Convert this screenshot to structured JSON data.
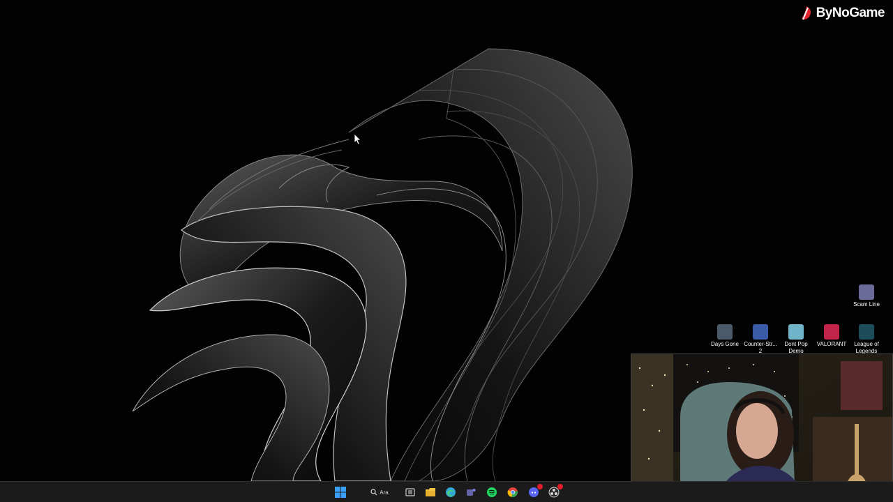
{
  "watermark": {
    "text": "ByNoGame"
  },
  "desktop_icons": [
    {
      "label": "Scam Line",
      "icon": "scam-line-icon",
      "color": "#6b6b9a"
    },
    {
      "label": "Days Gone",
      "icon": "days-gone-icon",
      "color": "#4a5a6a"
    },
    {
      "label": "Counter-Str... 2",
      "icon": "counter-strike-icon",
      "color": "#3a5ba8"
    },
    {
      "label": "Dont Pop Demo",
      "icon": "dont-pop-demo-icon",
      "color": "#6fb4c9"
    },
    {
      "label": "VALORANT",
      "icon": "valorant-icon",
      "color": "#c2254a"
    },
    {
      "label": "League of Legends",
      "icon": "league-of-legends-icon",
      "color": "#1d4c5a"
    }
  ],
  "taskbar": {
    "search_label": "Ara",
    "items": [
      {
        "name": "start-button",
        "icon": "windows-icon",
        "color": "#3aa0ff"
      },
      {
        "name": "task-view-button",
        "icon": "task-view-icon",
        "color": "#cfcfcf"
      },
      {
        "name": "file-explorer-button",
        "icon": "folder-icon",
        "color": "#f3c343"
      },
      {
        "name": "edge-button",
        "icon": "edge-icon",
        "color": "#2ea8d8"
      },
      {
        "name": "teams-button",
        "icon": "teams-icon",
        "color": "#6264a7"
      },
      {
        "name": "spotify-button",
        "icon": "spotify-icon",
        "color": "#1ed760"
      },
      {
        "name": "chrome-button",
        "icon": "chrome-icon",
        "color": "#e0443a"
      },
      {
        "name": "discord-button",
        "icon": "discord-icon",
        "color": "#5865f2"
      },
      {
        "name": "obs-button",
        "icon": "obs-icon",
        "color": "#d8d8d8"
      }
    ]
  },
  "colors": {
    "background": "#000000",
    "taskbar": "#1b1b1b",
    "accent": "#3aa0ff"
  }
}
